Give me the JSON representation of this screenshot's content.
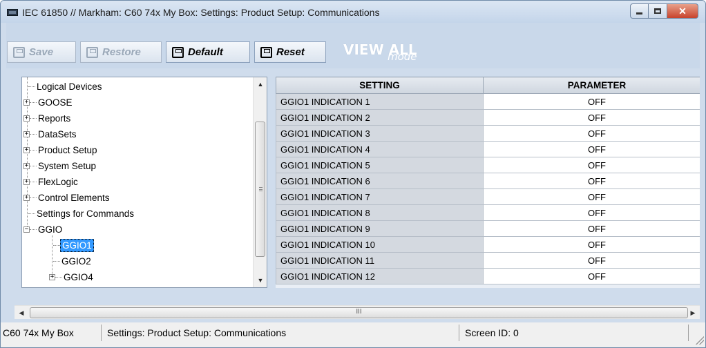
{
  "window": {
    "title": "IEC 61850 // Markham: C60 74x My Box: Settings: Product Setup: Communications"
  },
  "toolbar": {
    "save_label": "Save",
    "restore_label": "Restore",
    "default_label": "Default",
    "reset_label": "Reset",
    "viewall_big": "VIEW ALL",
    "viewall_small": "mode"
  },
  "tree": {
    "items": [
      {
        "label": "Logical Devices",
        "expander": ""
      },
      {
        "label": "GOOSE",
        "expander": "+"
      },
      {
        "label": "Reports",
        "expander": "+"
      },
      {
        "label": "DataSets",
        "expander": "+"
      },
      {
        "label": "Product Setup",
        "expander": "+"
      },
      {
        "label": "System Setup",
        "expander": "+"
      },
      {
        "label": "FlexLogic",
        "expander": "+"
      },
      {
        "label": "Control Elements",
        "expander": "+"
      },
      {
        "label": "Settings for Commands",
        "expander": ""
      },
      {
        "label": "GGIO",
        "expander": "−"
      },
      {
        "label": "GGIO1",
        "expander": "",
        "selected": true
      },
      {
        "label": "GGIO2",
        "expander": ""
      },
      {
        "label": "GGIO4",
        "expander": "+"
      }
    ]
  },
  "grid": {
    "headers": {
      "setting": "SETTING",
      "parameter": "PARAMETER"
    },
    "rows": [
      {
        "setting": "GGIO1 INDICATION 1",
        "parameter": "OFF"
      },
      {
        "setting": "GGIO1 INDICATION 2",
        "parameter": "OFF"
      },
      {
        "setting": "GGIO1 INDICATION 3",
        "parameter": "OFF"
      },
      {
        "setting": "GGIO1 INDICATION 4",
        "parameter": "OFF"
      },
      {
        "setting": "GGIO1 INDICATION 5",
        "parameter": "OFF"
      },
      {
        "setting": "GGIO1 INDICATION 6",
        "parameter": "OFF"
      },
      {
        "setting": "GGIO1 INDICATION 7",
        "parameter": "OFF"
      },
      {
        "setting": "GGIO1 INDICATION 8",
        "parameter": "OFF"
      },
      {
        "setting": "GGIO1 INDICATION 9",
        "parameter": "OFF"
      },
      {
        "setting": "GGIO1 INDICATION 10",
        "parameter": "OFF"
      },
      {
        "setting": "GGIO1 INDICATION 11",
        "parameter": "OFF"
      },
      {
        "setting": "GGIO1 INDICATION 12",
        "parameter": "OFF"
      }
    ]
  },
  "hscroll": {
    "thumb_grip": "III"
  },
  "statusbar": {
    "device": "C60 74x My Box",
    "path": "Settings: Product Setup: Communications",
    "screen_id": "Screen ID: 0"
  },
  "icons": {
    "app": "device-icon",
    "save": "floppy-disk-icon",
    "restore": "floppy-disk-icon",
    "default": "floppy-disk-icon",
    "reset": "reset-icon"
  },
  "colors": {
    "selection": "#3399ff",
    "close_button": "#c8432c",
    "window_frame": "#cfdcec",
    "setting_cell": "#d4d9e0"
  }
}
